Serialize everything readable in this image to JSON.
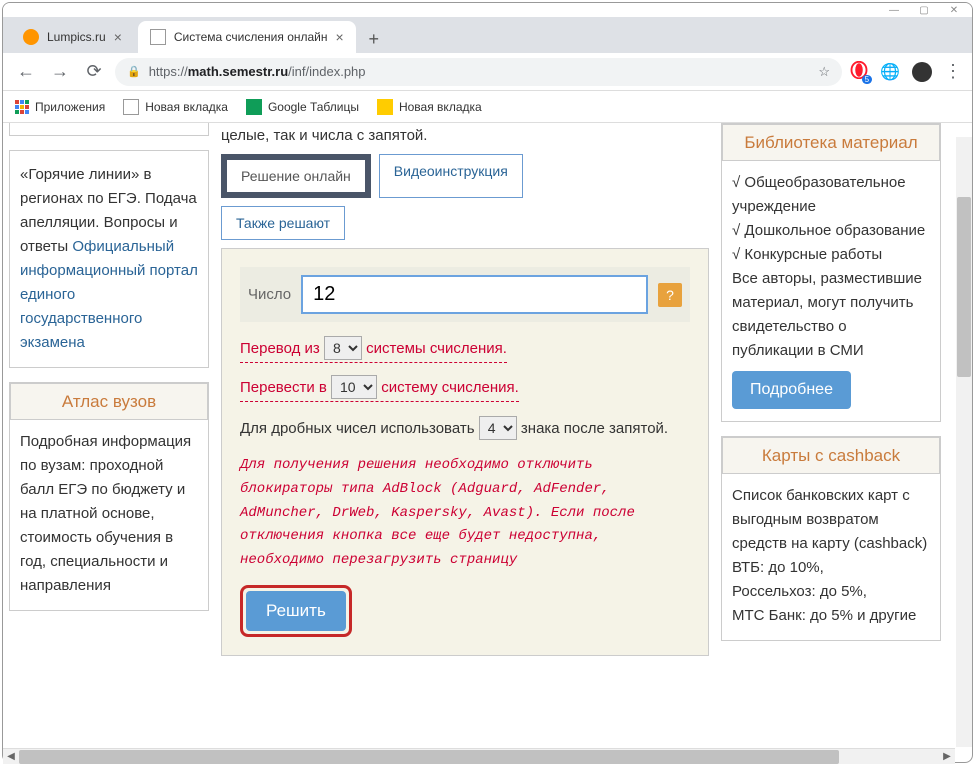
{
  "window": {
    "tabs": [
      {
        "title": "Lumpics.ru",
        "active": false
      },
      {
        "title": "Система счисления онлайн",
        "active": true
      }
    ],
    "url_prefix": "https://",
    "url_host": "math.semestr.ru",
    "url_path": "/inf/index.php"
  },
  "bookmarks": {
    "apps": "Приложения",
    "newtab1": "Новая вкладка",
    "sheets": "Google Таблицы",
    "newtab2": "Новая вкладка"
  },
  "sidebar_left": {
    "box1_text": "«Горячие линии» в регионах по ЕГЭ. Подача апелляции. Вопросы и ответы",
    "box1_link": "Официальный информационный портал единого государственного экзамена",
    "box2_title": "Атлас вузов",
    "box2_text": "Подробная информация по вузам: проходной балл ЕГЭ по бюджету и на платной основе, стоимость обучения в год, специальности и направления"
  },
  "main": {
    "top_text": "целые, так и числа с запятой.",
    "tabs": {
      "t1": "Решение онлайн",
      "t2": "Видеоинструкция",
      "t3": "Также решают"
    },
    "form": {
      "num_label": "Число",
      "num_value": "12",
      "help": "?",
      "from_label_a": "Перевод из",
      "from_value": "8",
      "from_label_b": "системы счисления.",
      "to_label_a": "Перевести в",
      "to_value": "10",
      "to_label_b": "систему счисления.",
      "frac_label_a": "Для дробных чисел использовать",
      "frac_value": "4",
      "frac_label_b": "знака после запятой.",
      "warning": "Для получения решения необходимо отключить блокираторы типа AdBlock (Adguard, AdFender, AdMuncher, DrWeb, Kaspersky, Avast). Если после отключения кнопка все еще будет недоступна, необходимо перезагрузить страницу",
      "solve_btn": "Решить"
    }
  },
  "sidebar_right": {
    "box1_title": "Библиотека материал",
    "box1_items": [
      "Общеобразовательное учреждение",
      "Дошкольное образование",
      "Конкурсные работы"
    ],
    "box1_text": "Все авторы, разместившие материал, могут получить свидетельство о публикации в СМИ",
    "box1_btn": "Подробнее",
    "box2_title": "Карты с cashback",
    "box2_intro": "Список банковских карт с выгодным возвратом средств на карту (cashback)",
    "box2_lines": [
      "ВТБ: до 10%,",
      "Россельхоз: до 5%,",
      "МТС Банк: до 5% и другие"
    ]
  }
}
